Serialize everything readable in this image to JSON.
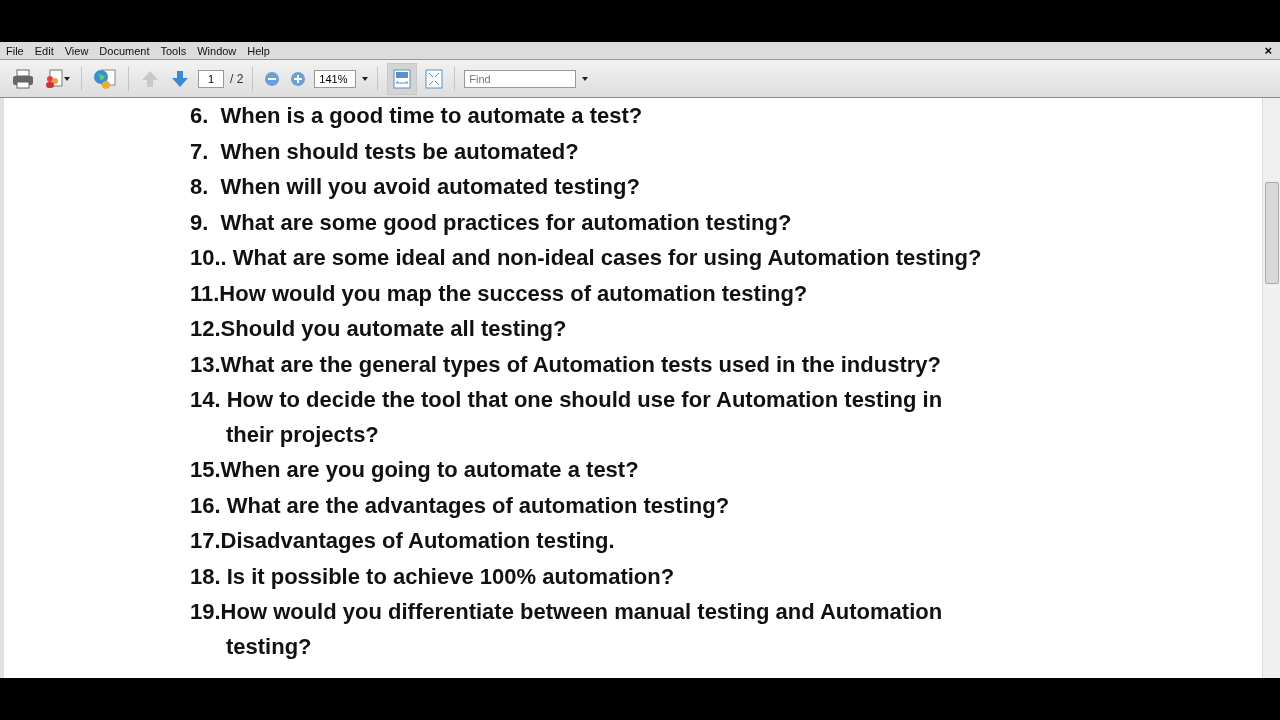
{
  "menu": [
    "File",
    "Edit",
    "View",
    "Document",
    "Tools",
    "Window",
    "Help"
  ],
  "close_button": "×",
  "toolbar": {
    "page_number": "1",
    "page_total": "/ 2",
    "zoom": "141%",
    "find": {
      "placeholder": "Find"
    },
    "previous_page_disabled": true,
    "fit_width_selected": true
  },
  "document": {
    "items": [
      {
        "lines": [
          "6.  When is a good time to automate a test?"
        ]
      },
      {
        "lines": [
          "7.  When should tests be automated?"
        ]
      },
      {
        "lines": [
          "8.  When will you avoid automated testing?"
        ]
      },
      {
        "lines": [
          "9.  What are some good practices for automation testing?"
        ]
      },
      {
        "lines": [
          "10.. What are some ideal and non-ideal cases for using Automation testing?"
        ]
      },
      {
        "lines": [
          "11.How would you map the success of automation testing?"
        ]
      },
      {
        "lines": [
          "12.Should you automate all testing?"
        ]
      },
      {
        "lines": [
          "13.What are the general types of Automation tests used in the industry?"
        ]
      },
      {
        "lines": [
          "14. How to decide the tool that one should use for Automation testing in",
          "their projects?"
        ]
      },
      {
        "lines": [
          "15.When are you going to automate a test?"
        ]
      },
      {
        "lines": [
          "16. What are the advantages of automation testing?"
        ]
      },
      {
        "lines": [
          "17.Disadvantages of Automation testing."
        ]
      },
      {
        "lines": [
          "18. Is it possible to achieve 100% automation?"
        ]
      },
      {
        "lines": [
          "19.How would you differentiate between manual testing and Automation",
          "testing?"
        ]
      }
    ]
  }
}
